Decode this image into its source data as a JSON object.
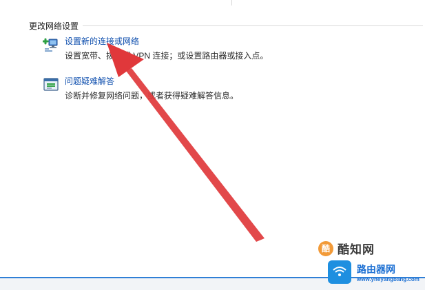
{
  "section": {
    "title": "更改网络设置"
  },
  "tasks": [
    {
      "link": "设置新的连接或网络",
      "description": "设置宽带、拨号或 VPN 连接；或设置路由器或接入点。",
      "icon": "network-setup-icon"
    },
    {
      "link": "问题疑难解答",
      "description": "诊断并修复网络问题，或者获得疑难解答信息。",
      "icon": "troubleshoot-icon"
    }
  ],
  "annotation": {
    "arrow_color": "#e0383b"
  },
  "watermarks": {
    "badge": "酷",
    "text1": "酷知网",
    "text2": "路由器网",
    "url": "www.yneyangbang.com"
  },
  "colors": {
    "link": "#0f4fae",
    "accent": "#2f7fd6"
  }
}
